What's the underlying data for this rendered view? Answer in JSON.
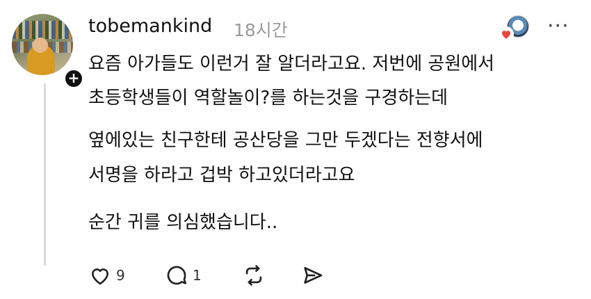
{
  "post": {
    "username": "tobemankind",
    "timestamp": "18시간",
    "paragraphs": [
      [
        "요즘 아가들도 이런거 잘 알더라고요. 저번에 공원에서",
        "초등학생들이 역할놀이?를 하는것을 구경하는데"
      ],
      [
        "옆에있는 친구한테 공산당을 그만 두겠다는 전향서에",
        "서명을 하라고 겁박 하고있더라고요"
      ],
      [
        "순간 귀를 의심했습니다.."
      ]
    ]
  },
  "actions": {
    "likes": "9",
    "replies": "1"
  },
  "icons": {
    "avatar": "profile-photo",
    "follow": "plus-icon",
    "liked_badge": "heart-icon",
    "more": "more-options-icon",
    "like": "heart-outline-icon",
    "reply": "comment-icon",
    "repost": "repost-icon",
    "share": "send-icon"
  },
  "colors": {
    "text": "#111111",
    "muted": "#9a9a9a",
    "heart": "#e8453c",
    "thread_line": "#d9d9d9"
  }
}
